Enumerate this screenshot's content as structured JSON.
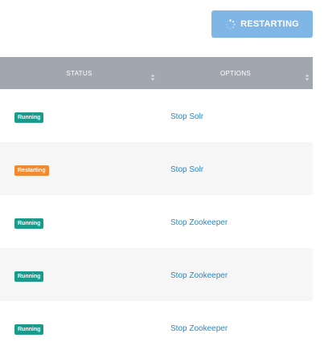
{
  "toolbar": {
    "restart_label": "RESTARTING"
  },
  "table": {
    "headers": {
      "status": "STATUS",
      "options": "OPTIONS"
    },
    "rows": [
      {
        "status": "Running",
        "action": "Stop Solr"
      },
      {
        "status": "Restarting",
        "action": "Stop Solr"
      },
      {
        "status": "Running",
        "action": "Stop Zookeeper"
      },
      {
        "status": "Running",
        "action": "Stop Zookeeper"
      },
      {
        "status": "Running",
        "action": "Stop Zookeeper"
      }
    ]
  },
  "colors": {
    "running": "#1a9a8a",
    "restarting": "#f08a34",
    "link": "#2589c9",
    "header_bg": "#a2a6ae",
    "button_bg": "#7fb6e6"
  },
  "icons": {
    "spinner": "spinner-icon",
    "sort": "sort-icon"
  }
}
